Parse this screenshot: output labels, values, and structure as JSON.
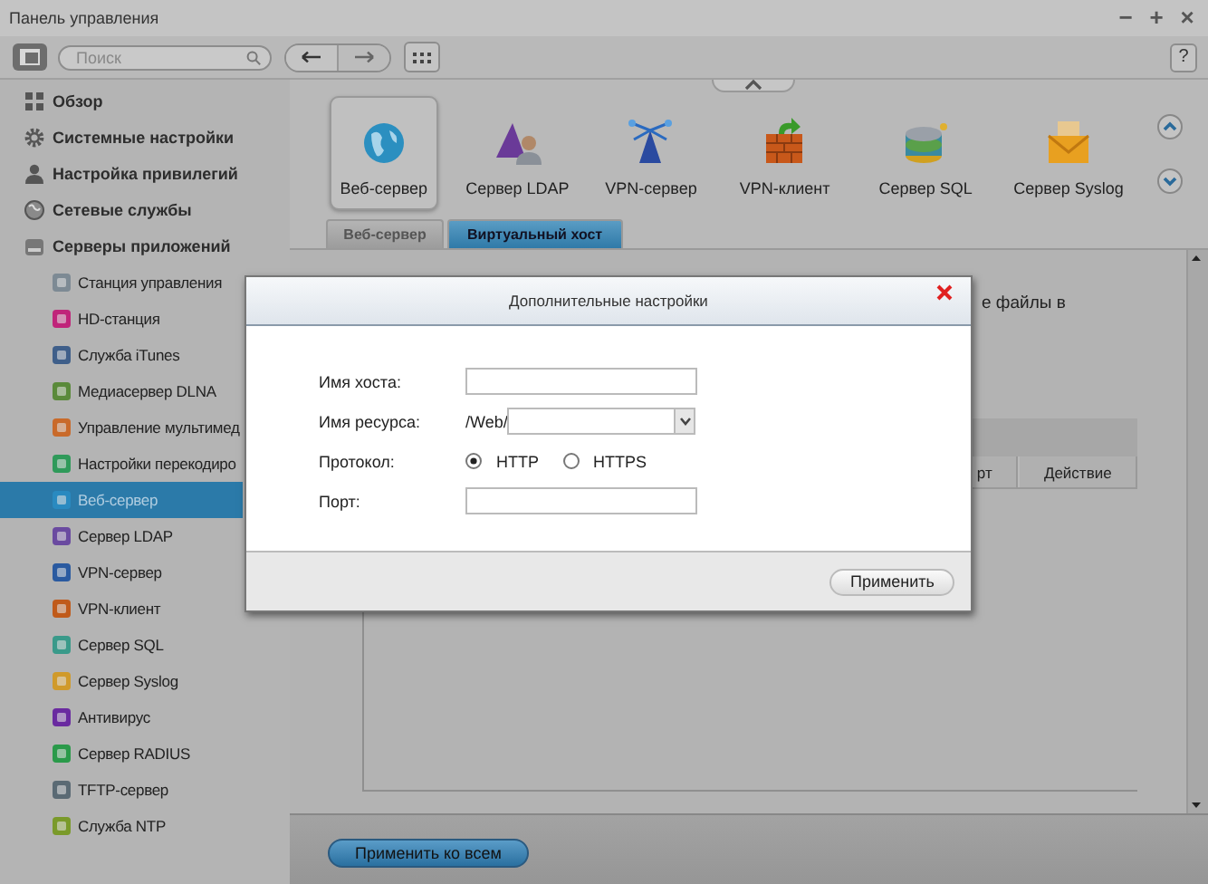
{
  "window": {
    "title": "Панель управления",
    "controls": [
      "−",
      "+",
      "×"
    ]
  },
  "toolbar": {
    "search": {
      "placeholder": "Поиск"
    },
    "help": "?"
  },
  "sidebar": {
    "items": [
      {
        "label": "Обзор",
        "selected": false
      },
      {
        "label": "Системные настройки",
        "selected": false
      },
      {
        "label": "Настройка привилегий",
        "selected": false
      },
      {
        "label": "Сетевые службы",
        "selected": false
      },
      {
        "label": "Серверы приложений",
        "selected": false,
        "children": [
          {
            "label": "Станция управления",
            "selected": false
          },
          {
            "label": "HD-станция",
            "selected": false
          },
          {
            "label": "Служба iTunes",
            "selected": false
          },
          {
            "label": "Медиасервер DLNA",
            "selected": false
          },
          {
            "label": "Управление мультимед",
            "selected": false
          },
          {
            "label": "Настройки перекодиро",
            "selected": false
          },
          {
            "label": "Веб-сервер",
            "selected": true
          },
          {
            "label": "Сервер LDAP",
            "selected": false
          },
          {
            "label": "VPN-сервер",
            "selected": false
          },
          {
            "label": "VPN-клиент",
            "selected": false
          },
          {
            "label": "Сервер SQL",
            "selected": false
          },
          {
            "label": "Сервер Syslog",
            "selected": false
          },
          {
            "label": "Антивирус",
            "selected": false
          },
          {
            "label": "Сервер RADIUS",
            "selected": false
          },
          {
            "label": "TFTP-сервер",
            "selected": false
          },
          {
            "label": "Служба NTP",
            "selected": false
          }
        ]
      }
    ]
  },
  "app_icons": [
    {
      "label": "Веб-сервер",
      "selected": true
    },
    {
      "label": "Сервер LDAP",
      "selected": false
    },
    {
      "label": "VPN-сервер",
      "selected": false
    },
    {
      "label": "VPN-клиент",
      "selected": false
    },
    {
      "label": "Сервер SQL",
      "selected": false
    },
    {
      "label": "Сервер Syslog",
      "selected": false
    }
  ],
  "tabs": [
    {
      "label": "Веб-сервер",
      "selected": false
    },
    {
      "label": "Виртуальный хост",
      "selected": true
    }
  ],
  "background_panel": {
    "text_fragment": "е файлы в",
    "table": {
      "columns": [
        "рт",
        "Действие"
      ]
    }
  },
  "dialog": {
    "title": "Дополнительные настройки",
    "fields": [
      {
        "kind": "text",
        "label": "Имя хоста:"
      },
      {
        "kind": "select",
        "label": "Имя ресурса:",
        "prefix": "/Web/"
      },
      {
        "kind": "radio",
        "label": "Протокол:",
        "options": [
          {
            "label": "HTTP",
            "selected": true
          },
          {
            "label": "HTTPS",
            "selected": false
          }
        ]
      },
      {
        "kind": "text",
        "label": "Порт:"
      }
    ],
    "button": "Применить"
  },
  "footer": {
    "button": "Применить ко всем"
  }
}
